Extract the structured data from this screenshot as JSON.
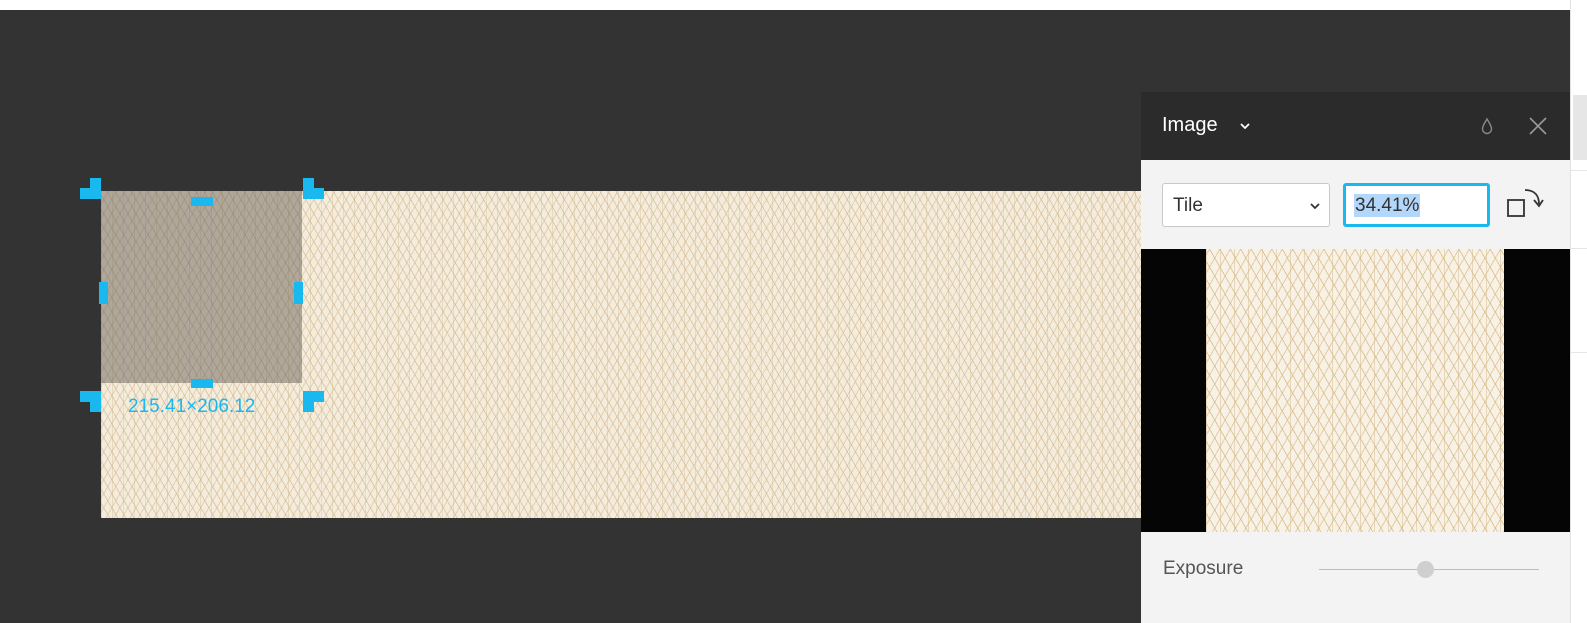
{
  "selection": {
    "dimensions": "215.41×206.12"
  },
  "panel": {
    "title": "Image",
    "fill_mode": {
      "selected": "Tile"
    },
    "scale": {
      "value": "34.41%"
    },
    "exposure": {
      "label": "Exposure",
      "level": 0.5
    }
  },
  "colors": {
    "canvas_background": "#333333",
    "selection_accent": "#19b8ef",
    "panel_header": "#2b2b2b",
    "panel_body": "#f3f3f3"
  },
  "icons": {
    "title_dropdown": "chevron-down-icon",
    "opacity": "drop-icon",
    "close": "close-icon",
    "mode_dropdown": "chevron-down-icon",
    "rotate": "rotate-icon"
  }
}
